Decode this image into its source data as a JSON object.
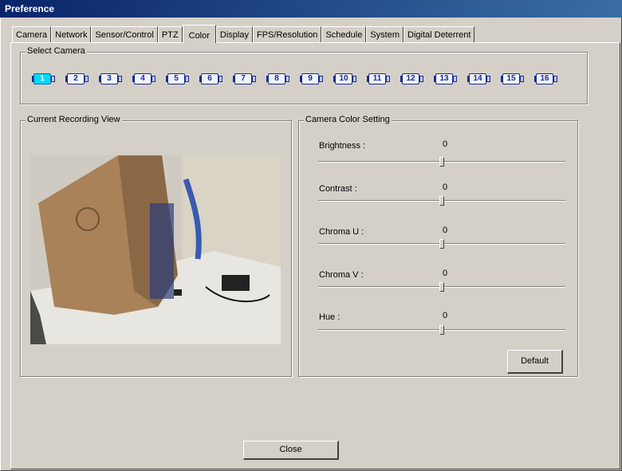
{
  "window": {
    "title": "Preference"
  },
  "tabs": [
    {
      "label": "Camera"
    },
    {
      "label": "Network"
    },
    {
      "label": "Sensor/Control"
    },
    {
      "label": "PTZ"
    },
    {
      "label": "Color"
    },
    {
      "label": "Display"
    },
    {
      "label": "FPS/Resolution"
    },
    {
      "label": "Schedule"
    },
    {
      "label": "System"
    },
    {
      "label": "Digital Deterrent"
    }
  ],
  "active_tab": "Color",
  "select_camera": {
    "legend": "Select Camera",
    "cameras": [
      "1",
      "2",
      "3",
      "4",
      "5",
      "6",
      "7",
      "8",
      "9",
      "10",
      "11",
      "12",
      "13",
      "14",
      "15",
      "16"
    ],
    "selected": "1"
  },
  "recording_view": {
    "legend": "Current Recording View"
  },
  "color_setting": {
    "legend": "Camera Color Setting",
    "sliders": [
      {
        "label": "Brightness :",
        "value": "0"
      },
      {
        "label": "Contrast :",
        "value": "0"
      },
      {
        "label": "Chroma U :",
        "value": "0"
      },
      {
        "label": "Chroma V :",
        "value": "0"
      },
      {
        "label": "Hue :",
        "value": "0"
      }
    ],
    "slider_position": 0.5,
    "default_label": "Default"
  },
  "close_label": "Close",
  "colors": {
    "titlebar": "#0a246a",
    "face": "#d4d0c8",
    "selected_camera": "#00d8ff"
  }
}
